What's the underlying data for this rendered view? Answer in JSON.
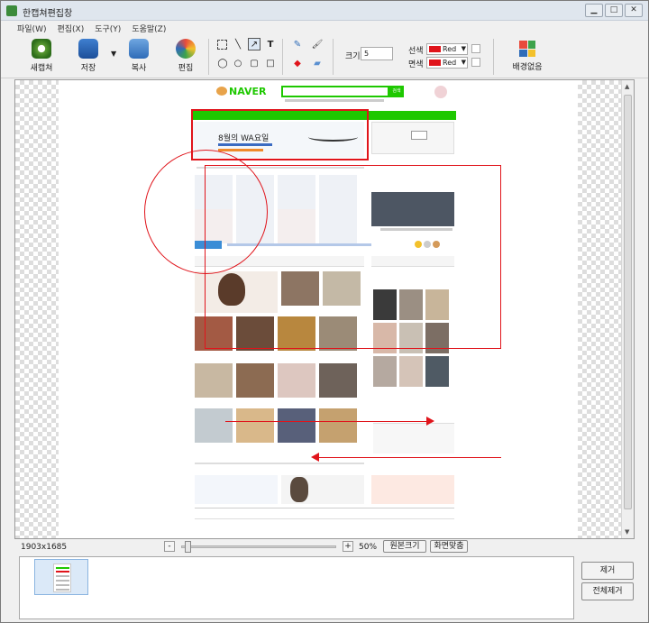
{
  "window": {
    "title": "한캡쳐편집창"
  },
  "menu": [
    "파일(W)",
    "편집(X)",
    "도구(Y)",
    "도움말(Z)"
  ],
  "toolbar": {
    "new_capture": "새캡쳐",
    "save": "저장",
    "copy": "복사",
    "edit": "편집",
    "size_label": "크기",
    "size_value": "5",
    "line_label": "선색",
    "line_color_name": "Red",
    "fill_label": "면색",
    "fill_color_name": "Red",
    "background": "배경없음"
  },
  "colors": {
    "annotation": "#e0141b",
    "naver_green": "#1ec800"
  },
  "screenshot": {
    "site_name": "NAVER",
    "banner_title": "8월의 WA요일"
  },
  "status": {
    "dimensions": "1903x1685",
    "zoom_minus": "-",
    "zoom_plus": "+",
    "zoom": "50%",
    "zoom_percent": 0.5,
    "original_size": "원본크기",
    "fit_screen": "화면맞춤"
  },
  "side": {
    "remove": "제거",
    "remove_all": "전체제거"
  }
}
